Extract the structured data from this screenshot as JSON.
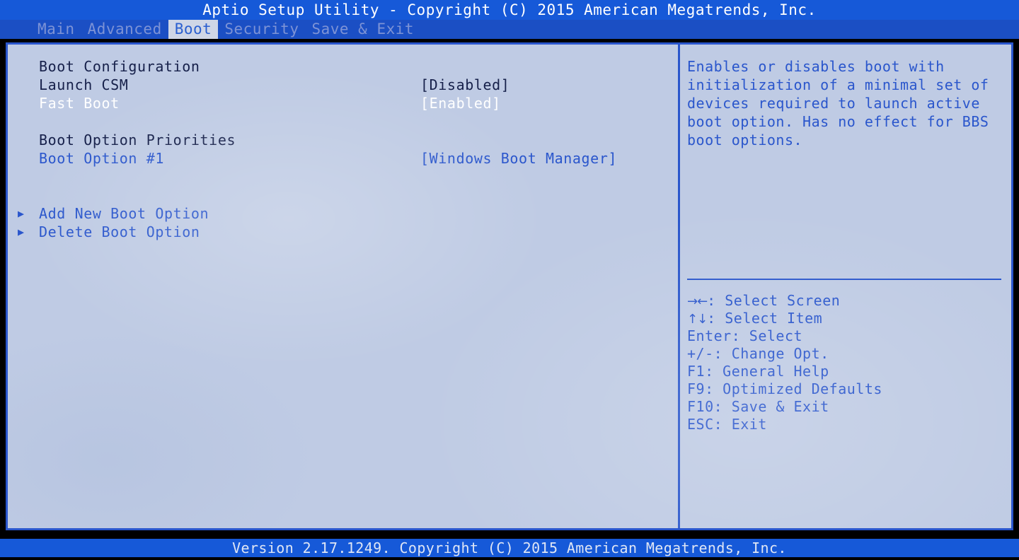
{
  "titlebar": {
    "text": "Aptio Setup Utility - Copyright (C) 2015 American Megatrends, Inc."
  },
  "menubar": {
    "items": [
      {
        "label": "Main",
        "active": false
      },
      {
        "label": "Advanced",
        "active": false
      },
      {
        "label": "Boot",
        "active": true
      },
      {
        "label": "Security",
        "active": false
      },
      {
        "label": "Save & Exit",
        "active": false
      }
    ]
  },
  "settings": {
    "rows": [
      {
        "marker": "",
        "label": "Boot Configuration",
        "value": "",
        "style": "head"
      },
      {
        "marker": "",
        "label": "Launch CSM",
        "value": "[Disabled]",
        "style": "normal"
      },
      {
        "marker": "",
        "label": "Fast Boot",
        "value": "[Enabled]",
        "style": "sel"
      },
      {
        "marker": "",
        "label": "",
        "value": "",
        "style": "spacer"
      },
      {
        "marker": "",
        "label": "Boot Option Priorities",
        "value": "",
        "style": "head"
      },
      {
        "marker": "",
        "label": "Boot Option #1",
        "value": "[Windows Boot Manager]",
        "style": "link"
      },
      {
        "marker": "",
        "label": "",
        "value": "",
        "style": "spacer"
      },
      {
        "marker": "",
        "label": "",
        "value": "",
        "style": "spacer"
      },
      {
        "marker": "▶",
        "label": "Add New Boot Option",
        "value": "",
        "style": "link"
      },
      {
        "marker": "▶",
        "label": "Delete Boot Option",
        "value": "",
        "style": "link"
      }
    ]
  },
  "help": {
    "description": "Enables or disables boot with initialization of a minimal set of devices required to launch active boot option. Has no effect for BBS boot options.",
    "keys": [
      {
        "glyph": "→←",
        "text": ": Select Screen"
      },
      {
        "glyph": "↑↓",
        "text": ": Select Item"
      },
      {
        "glyph": "",
        "text": "Enter: Select"
      },
      {
        "glyph": "",
        "text": "+/-: Change Opt."
      },
      {
        "glyph": "",
        "text": "F1: General Help"
      },
      {
        "glyph": "",
        "text": "F9: Optimized Defaults"
      },
      {
        "glyph": "",
        "text": "F10: Save & Exit"
      },
      {
        "glyph": "",
        "text": "ESC: Exit"
      }
    ]
  },
  "footer": {
    "text": "Version 2.17.1249. Copyright (C) 2015 American Megatrends, Inc."
  },
  "colors": {
    "title_bar_blue": "#1659d8",
    "menu_bar_blue": "#1b4fc4",
    "panel_background": "#bfcbe4",
    "border_blue": "#2a56cc",
    "text_dark": "#16204a",
    "text_selected": "#ffffff",
    "text_link": "#2a56cc",
    "menu_inactive": "#7d93d6",
    "bezel_black": "#000000"
  }
}
